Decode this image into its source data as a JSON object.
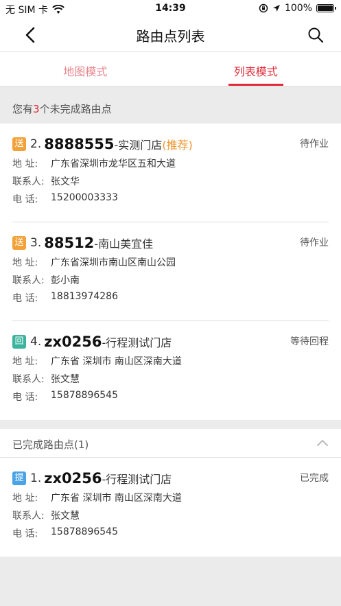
{
  "status_bar": {
    "carrier": "无 SIM 卡",
    "time": "14:39",
    "battery": "100%",
    "battery_level": 1.0
  },
  "nav": {
    "title": "路由点列表"
  },
  "tabs": [
    {
      "label": "地图模式",
      "active": false
    },
    {
      "label": "列表模式",
      "active": true
    }
  ],
  "summary": {
    "prefix": "您有",
    "count": "3",
    "suffix": "个未完成路由点"
  },
  "labels": {
    "address": "地 址:",
    "contact": "联系人:",
    "phone": "电 话:"
  },
  "pending_stops": [
    {
      "badge": "送",
      "badge_type": "deliver",
      "index": "2.",
      "code": "8888555",
      "name": "-实测门店",
      "recommend": "(推荐)",
      "status": "待作业",
      "address": "广东省深圳市龙华区五和大道",
      "contact": "张文华",
      "phone": "15200003333"
    },
    {
      "badge": "送",
      "badge_type": "deliver",
      "index": "3.",
      "code": "88512",
      "name": "-南山美宜佳",
      "recommend": "",
      "status": "待作业",
      "address": "广东省深圳市南山区南山公园",
      "contact": "彭小南",
      "phone": "18813974286"
    },
    {
      "badge": "回",
      "badge_type": "return",
      "index": "4.",
      "code": "zx0256",
      "name": "-行程测试门店",
      "recommend": "",
      "status": "等待回程",
      "address": "广东省 深圳市 南山区深南大道",
      "contact": "张文慧",
      "phone": "15878896545"
    }
  ],
  "completed_section": {
    "title": "已完成路由点(1)"
  },
  "completed_stops": [
    {
      "badge": "提",
      "badge_type": "pickup",
      "index": "1.",
      "code": "zx0256",
      "name": "-行程测试门店",
      "status": "已完成",
      "address": "广东省 深圳市 南山区深南大道",
      "contact": "张文慧",
      "phone": "15878896545"
    }
  ],
  "colors": {
    "accent": "#e02937",
    "tab_inactive": "#e8858e",
    "recommend": "#f0962c",
    "badge_deliver": "#f3a23a",
    "badge_return": "#3bb39e",
    "badge_pickup": "#4aa3e6"
  },
  "icons": {
    "wifi": "wifi-icon",
    "orientation_lock": "orientation-lock-icon",
    "location": "location-arrow-icon",
    "back": "back-chevron-icon",
    "search": "search-icon",
    "collapse": "chevron-up-icon"
  }
}
